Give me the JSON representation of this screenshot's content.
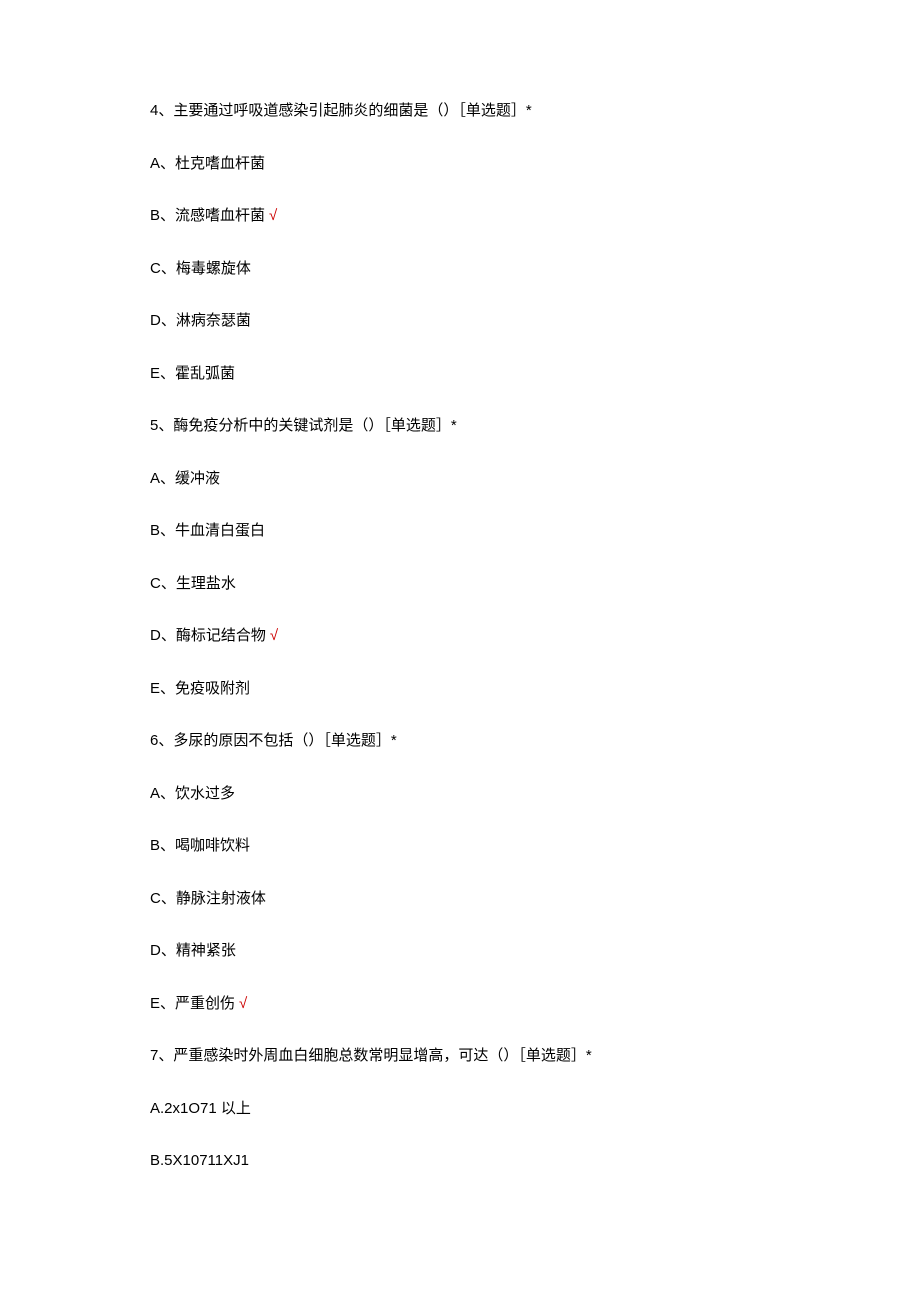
{
  "questions": [
    {
      "stem": "4、主要通过呼吸道感染引起肺炎的细菌是（）［单选题］*",
      "options": [
        {
          "text": "A、杜克嗜血杆菌",
          "correct": false
        },
        {
          "text": "B、流感嗜血杆菌",
          "correct": true
        },
        {
          "text": "C、梅毒螺旋体",
          "correct": false
        },
        {
          "text": "D、淋病奈瑟菌",
          "correct": false
        },
        {
          "text": "E、霍乱弧菌",
          "correct": false
        }
      ]
    },
    {
      "stem": "5、酶免疫分析中的关键试剂是（）［单选题］*",
      "options": [
        {
          "text": "A、缓冲液",
          "correct": false
        },
        {
          "text": "B、牛血清白蛋白",
          "correct": false
        },
        {
          "text": "C、生理盐水",
          "correct": false
        },
        {
          "text": "D、酶标记结合物",
          "correct": true
        },
        {
          "text": "E、免疫吸附剂",
          "correct": false
        }
      ]
    },
    {
      "stem": "6、多尿的原因不包括（）［单选题］*",
      "options": [
        {
          "text": "A、饮水过多",
          "correct": false
        },
        {
          "text": "B、喝咖啡饮料",
          "correct": false
        },
        {
          "text": "C、静脉注射液体",
          "correct": false
        },
        {
          "text": "D、精神紧张",
          "correct": false
        },
        {
          "text": "E、严重创伤",
          "correct": true
        }
      ]
    },
    {
      "stem": "7、严重感染时外周血白细胞总数常明显增高，可达（）［单选题］*",
      "options": [
        {
          "text": "A.2x1O71 以上",
          "correct": false
        },
        {
          "text": "B.5X10711XJ1",
          "correct": false
        }
      ]
    }
  ],
  "checkmark": "√"
}
